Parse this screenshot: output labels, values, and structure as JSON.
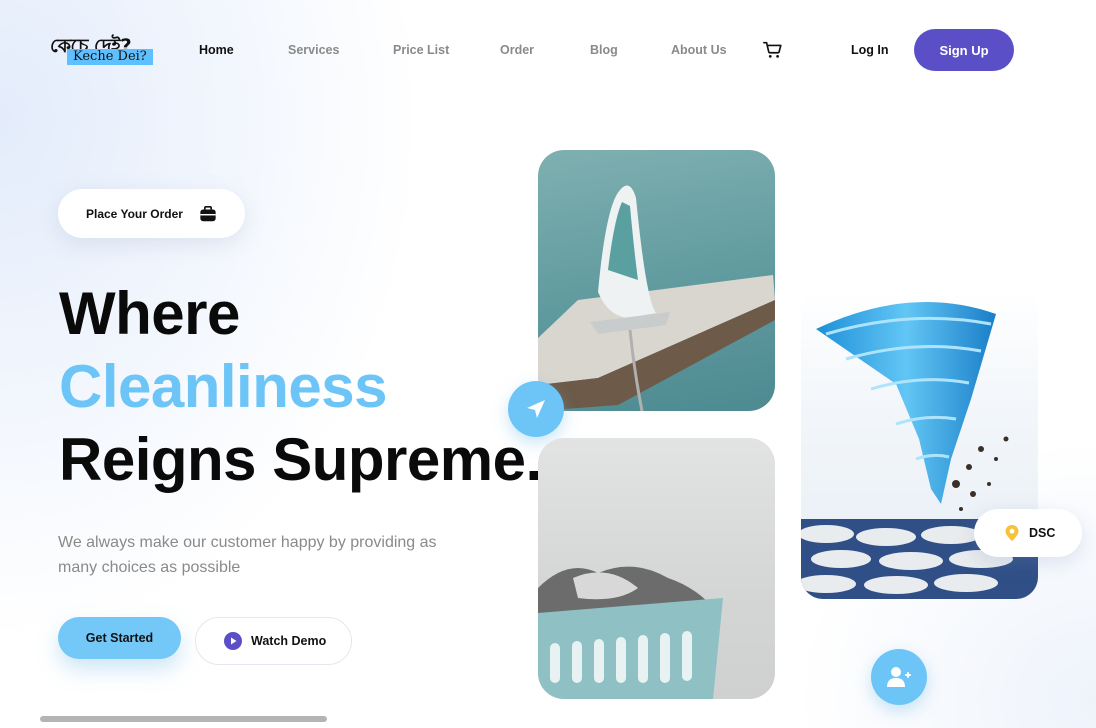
{
  "logo": {
    "bengali": "কেচে দেই?",
    "english": "Keche Dei?"
  },
  "nav": {
    "items": [
      {
        "label": "Home",
        "active": true
      },
      {
        "label": "Services"
      },
      {
        "label": "Price List"
      },
      {
        "label": "Order"
      },
      {
        "label": "Blog"
      },
      {
        "label": "About Us"
      }
    ],
    "cart_icon": "cart-icon",
    "login_label": "Log In",
    "signup_label": "Sign Up"
  },
  "hero": {
    "badge_label": "Place Your Order",
    "badge_icon": "briefcase-icon",
    "headline_1": "Where",
    "headline_2": "Cleanliness",
    "headline_3": "Reigns Supreme.",
    "description": "We always make our customer happy by providing as many choices as possible",
    "primary_cta": "Get Started",
    "secondary_cta": "Watch Demo"
  },
  "gallery": {
    "location_label": "DSC",
    "location_icon": "location-pin-icon",
    "send_icon": "send-icon",
    "add_user_icon": "add-user-icon"
  },
  "colors": {
    "accent_blue": "#6cc5f6",
    "brand_purple": "#5b4fc7",
    "text_dark": "#0a0a0a",
    "text_muted": "#8a8a8a"
  }
}
